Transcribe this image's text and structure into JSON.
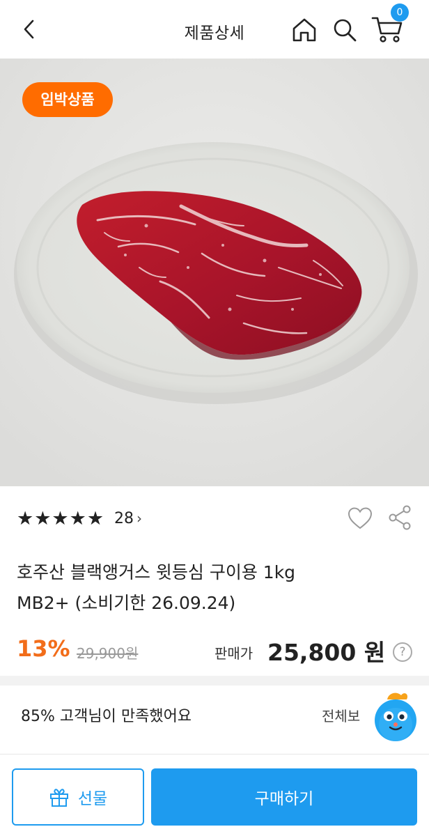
{
  "header": {
    "title": "제품상세",
    "cart_count": "0",
    "icons": {
      "back": "chevron-left-icon",
      "home": "home-icon",
      "search": "search-icon",
      "cart": "cart-icon"
    }
  },
  "hero": {
    "badge": "임박상품",
    "image": "raw-beef-steak-on-plate"
  },
  "rating": {
    "stars": "★★★★★",
    "star_count": 5,
    "review_count": "28",
    "chevron": "›"
  },
  "product": {
    "title_line1": "호주산 블랙앵거스 윗등심 구이용 1kg",
    "title_line2": "MB2+ (소비기한 26.09.24)"
  },
  "price": {
    "discount": "13%",
    "original": "29,900원",
    "sale_label": "판매가",
    "sale_price": "25,800 원",
    "help": "?"
  },
  "satisfaction": {
    "text": "85% 고객님이 만족했어요",
    "view_all": "전체보"
  },
  "bottom": {
    "gift_label": "선물",
    "buy_label": "구매하기"
  },
  "colors": {
    "accent": "#1e9bef",
    "badge": "#ff6c00",
    "discount": "#f26d1a"
  }
}
